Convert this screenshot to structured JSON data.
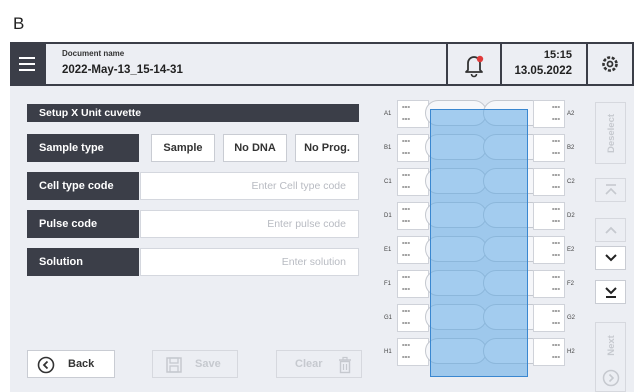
{
  "figure_label": "B",
  "header": {
    "doc_label": "Document name",
    "doc_name": "2022-May-13_15-14-31",
    "time": "15:15",
    "date": "13.05.2022",
    "icons": [
      "menu-icon",
      "bell-alert-icon",
      "gear-icon"
    ]
  },
  "form": {
    "title": "Setup X Unit cuvette",
    "sample_type": {
      "label": "Sample type",
      "options": [
        "Sample",
        "No DNA",
        "No Prog."
      ]
    },
    "cell_type": {
      "label": "Cell type code",
      "placeholder": "Enter Cell type code"
    },
    "pulse": {
      "label": "Pulse code",
      "placeholder": "Enter pulse code"
    },
    "solution": {
      "label": "Solution",
      "placeholder": "Enter solution"
    }
  },
  "buttons": {
    "back": "Back",
    "save": "Save",
    "clear": "Clear"
  },
  "wells": {
    "rows": [
      {
        "left": "A1",
        "right": "A2",
        "left_vals": [
          "---",
          "---"
        ],
        "right_vals": [
          "---",
          "---"
        ]
      },
      {
        "left": "B1",
        "right": "B2",
        "left_vals": [
          "---",
          "---"
        ],
        "right_vals": [
          "---",
          "---"
        ]
      },
      {
        "left": "C1",
        "right": "C2",
        "left_vals": [
          "---",
          "---"
        ],
        "right_vals": [
          "---",
          "---"
        ]
      },
      {
        "left": "D1",
        "right": "D2",
        "left_vals": [
          "---",
          "---"
        ],
        "right_vals": [
          "---",
          "---"
        ]
      },
      {
        "left": "E1",
        "right": "E2",
        "left_vals": [
          "---",
          "---"
        ],
        "right_vals": [
          "---",
          "---"
        ]
      },
      {
        "left": "F1",
        "right": "F2",
        "left_vals": [
          "---",
          "---"
        ],
        "right_vals": [
          "---",
          "---"
        ]
      },
      {
        "left": "G1",
        "right": "G2",
        "left_vals": [
          "---",
          "---"
        ],
        "right_vals": [
          "---",
          "---"
        ]
      },
      {
        "left": "H1",
        "right": "H2",
        "left_vals": [
          "---",
          "---"
        ],
        "right_vals": [
          "---",
          "---"
        ]
      }
    ],
    "selection_color": "#5faae6"
  },
  "sidebar": {
    "deselect": "Deselect",
    "next": "Next"
  },
  "colors": {
    "frame": "#3b3e48",
    "panel": "#eceef3",
    "alert": "#e03a3a"
  }
}
